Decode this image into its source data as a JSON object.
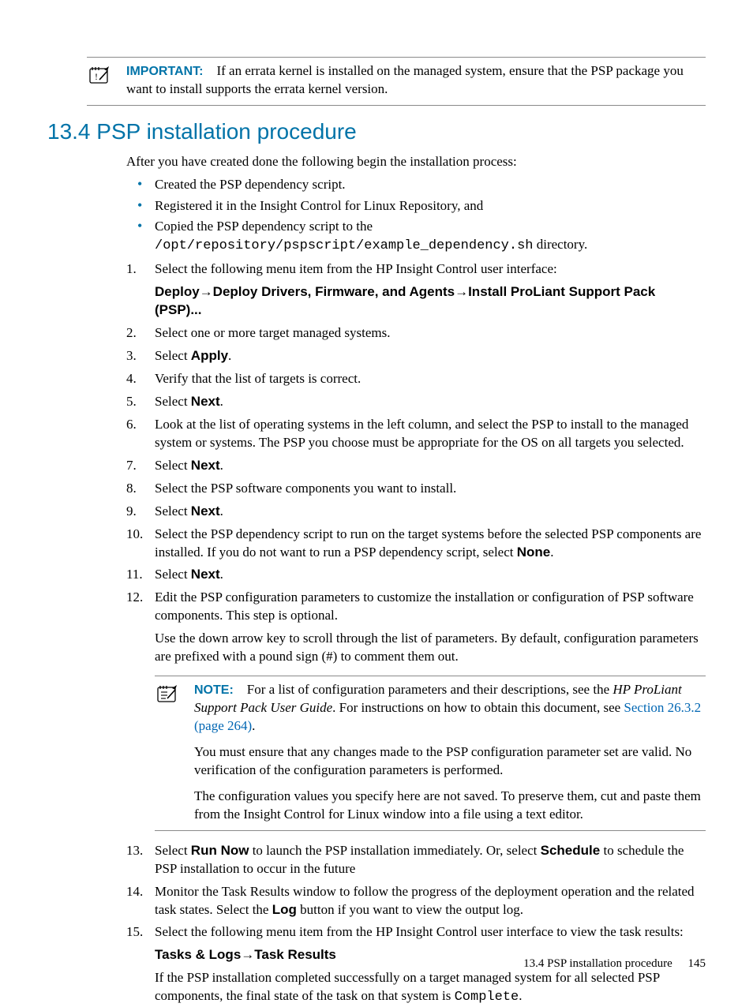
{
  "callout_important": {
    "label": "IMPORTANT:",
    "text": "If an errata kernel is installed on the managed system, ensure that the PSP package you want to install supports the errata kernel version."
  },
  "section": {
    "number": "13.4",
    "title": "PSP installation procedure",
    "heading_full": "13.4 PSP installation procedure"
  },
  "intro": "After you have created done the following begin the installation process:",
  "bullets": {
    "b1": "Created the PSP dependency script.",
    "b2": "Registered it in the Insight Control for Linux Repository, and",
    "b3_pre": "Copied the PSP dependency script to the ",
    "b3_path": "/opt/repository/pspscript/example_dependency.sh",
    "b3_post": " directory."
  },
  "menu_path_1": "Deploy→Deploy Drivers, Firmware, and Agents→Install ProLiant Support Pack (PSP)...",
  "menu_path_2": "Tasks & Logs→Task Results",
  "steps": {
    "s1": "Select the following menu item from the HP Insight Control user interface:",
    "s2": "Select one or more target managed systems.",
    "s3_a": "Select ",
    "s3_b": "Apply",
    "s3_c": ".",
    "s4": "Verify that the list of targets is correct.",
    "s5_a": "Select ",
    "s5_b": "Next",
    "s5_c": ".",
    "s6": "Look at the list of operating systems in the left column, and select the PSP to install to the managed system or systems. The PSP you choose must be appropriate for the OS on all targets you selected.",
    "s7_a": "Select ",
    "s7_b": "Next",
    "s7_c": ".",
    "s8": "Select the PSP software components you want to install.",
    "s9_a": "Select ",
    "s9_b": "Next",
    "s9_c": ".",
    "s10_a": "Select the PSP dependency script to run on the target systems before the selected PSP components are installed. If you do not want to run a PSP dependency script, select ",
    "s10_b": "None",
    "s10_c": ".",
    "s11_a": "Select ",
    "s11_b": "Next",
    "s11_c": ".",
    "s12_p1": "Edit the PSP configuration parameters to customize the installation or configuration of PSP software components. This step is optional.",
    "s12_p2": "Use the down arrow key to scroll through the list of parameters. By default, configuration parameters are prefixed with a pound sign (#) to comment them out.",
    "s13_a": "Select ",
    "s13_b": "Run Now",
    "s13_c": " to launch the PSP installation immediately. Or, select ",
    "s13_d": "Schedule",
    "s13_e": " to schedule the PSP installation to occur in the future",
    "s14_a": "Monitor the Task Results window to follow the progress of the deployment operation and the related task states. Select the ",
    "s14_b": "Log",
    "s14_c": " button if you want to view the output log.",
    "s15_p1": "Select the following menu item from the HP Insight Control user interface to view the task results:",
    "s15_p3_a": "If the PSP installation completed successfully on a target managed system for all selected PSP components, the final state of the task on that system is ",
    "s15_p3_b": "Complete",
    "s15_p3_c": "."
  },
  "note": {
    "label": "NOTE:",
    "p1_a": "For a list of configuration parameters and their descriptions, see the ",
    "p1_b": "HP ProLiant Support Pack User Guide",
    "p1_c": ". For instructions on how to obtain this document, see ",
    "p1_link": "Section 26.3.2 (page 264)",
    "p1_d": ".",
    "p2": "You must ensure that any changes made to the PSP configuration parameter set are valid. No verification of the configuration parameters is performed.",
    "p3": "The configuration values you specify here are not saved. To preserve them, cut and paste them from the Insight Control for Linux window into a file using a text editor."
  },
  "step_numbers": {
    "n1": "1.",
    "n2": "2.",
    "n3": "3.",
    "n4": "4.",
    "n5": "5.",
    "n6": "6.",
    "n7": "7.",
    "n8": "8.",
    "n9": "9.",
    "n10": "10.",
    "n11": "11.",
    "n12": "12.",
    "n13": "13.",
    "n14": "14.",
    "n15": "15."
  },
  "footer": {
    "title": "13.4 PSP installation procedure",
    "page": "145"
  }
}
